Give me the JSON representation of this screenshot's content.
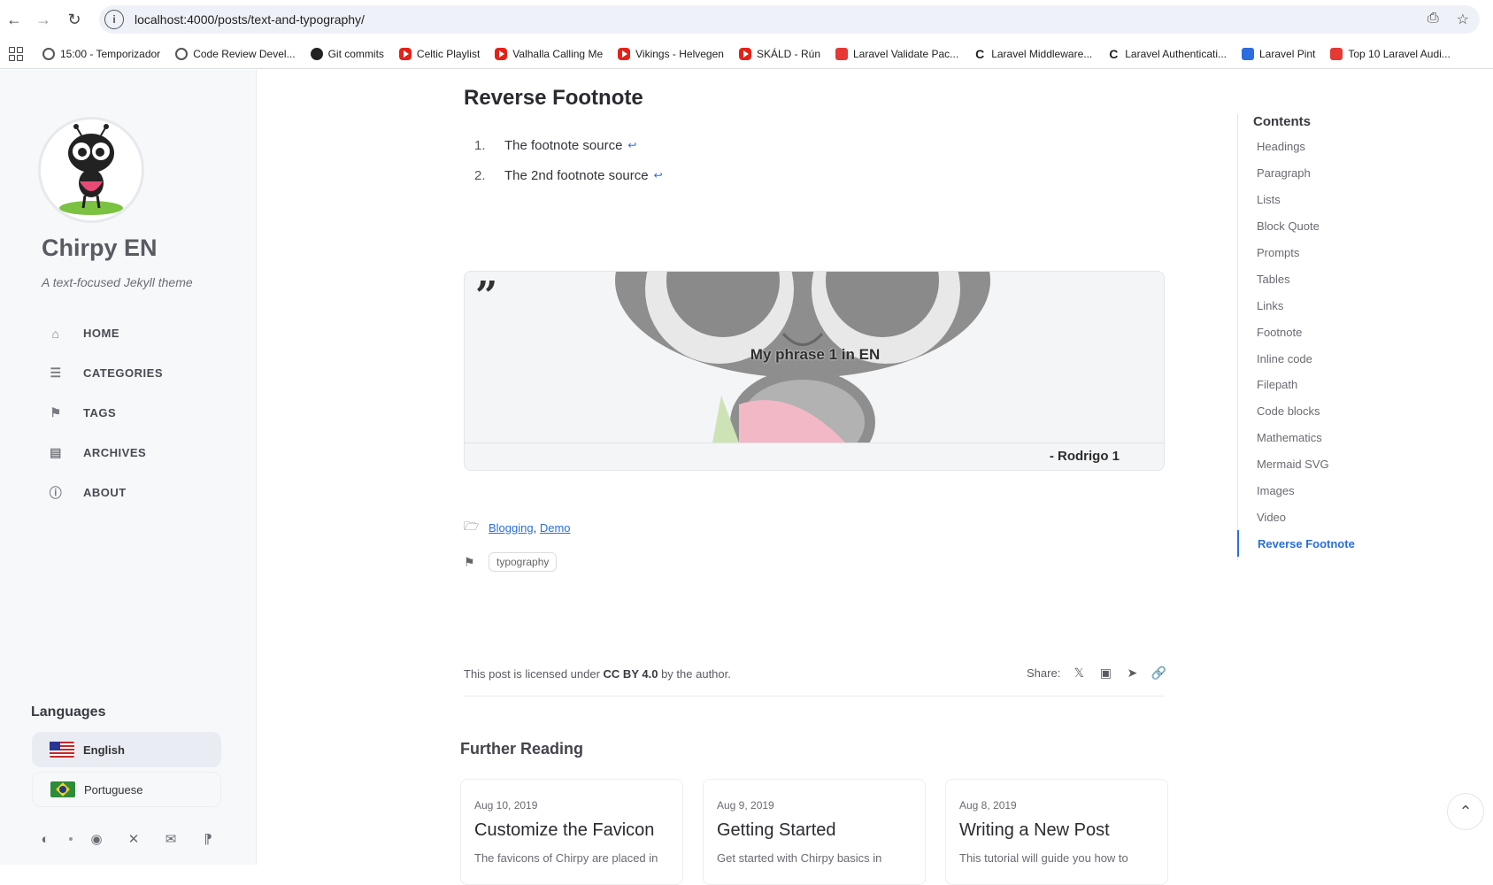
{
  "browser": {
    "url": "localhost:4000/posts/text-and-typography/",
    "bookmarks": [
      {
        "label": "15:00 - Temporizador",
        "icon": "timer-icon"
      },
      {
        "label": "Code Review Devel...",
        "icon": "globe-icon"
      },
      {
        "label": "Git commits",
        "icon": "github-icon"
      },
      {
        "label": "Celtic Playlist",
        "icon": "youtube-icon"
      },
      {
        "label": "Valhalla Calling Me",
        "icon": "youtube-icon"
      },
      {
        "label": "Vikings - Helvegen",
        "icon": "youtube-icon"
      },
      {
        "label": "SKÁLD - Rún",
        "icon": "youtube-icon"
      },
      {
        "label": "Laravel Validate Pac...",
        "icon": "laravel-news-icon"
      },
      {
        "label": "Laravel Middleware...",
        "icon": "c-icon"
      },
      {
        "label": "Laravel Authenticati...",
        "icon": "c-icon"
      },
      {
        "label": "Laravel Pint",
        "icon": "pint-icon"
      },
      {
        "label": "Top 10 Laravel Audi...",
        "icon": "laravel-news-icon"
      }
    ]
  },
  "sidebar": {
    "title": "Chirpy EN",
    "subtitle": "A text-focused Jekyll theme",
    "nav": [
      {
        "label": "HOME",
        "icon": "home-icon"
      },
      {
        "label": "CATEGORIES",
        "icon": "stream-icon"
      },
      {
        "label": "TAGS",
        "icon": "tags-icon"
      },
      {
        "label": "ARCHIVES",
        "icon": "archive-icon"
      },
      {
        "label": "ABOUT",
        "icon": "info-icon"
      }
    ],
    "languages_title": "Languages",
    "languages": [
      {
        "label": "English",
        "active": true
      },
      {
        "label": "Portuguese",
        "active": false
      }
    ]
  },
  "post": {
    "heading": "Reverse Footnote",
    "footnotes": [
      {
        "num": "1.",
        "text": "The footnote source",
        "back": "↩"
      },
      {
        "num": "2.",
        "text": "The 2nd footnote source",
        "back": "↩"
      }
    ],
    "quote": {
      "mark": "”",
      "text": "My phrase 1 in EN",
      "author": "- Rodrigo 1"
    },
    "categories": [
      "Blogging",
      "Demo"
    ],
    "category_sep": ",",
    "tags": [
      "typography"
    ],
    "license_prefix": "This post is licensed under",
    "license_name": "CC BY 4.0",
    "license_suffix": "by the author.",
    "share_label": "Share:",
    "further_title": "Further Reading",
    "cards": [
      {
        "date": "Aug 10, 2019",
        "title": "Customize the Favicon",
        "excerpt": "The favicons of Chirpy are placed in"
      },
      {
        "date": "Aug 9, 2019",
        "title": "Getting Started",
        "excerpt": "Get started with Chirpy basics in"
      },
      {
        "date": "Aug 8, 2019",
        "title": "Writing a New Post",
        "excerpt": "This tutorial will guide you how to"
      }
    ]
  },
  "toc": {
    "title": "Contents",
    "items": [
      "Headings",
      "Paragraph",
      "Lists",
      "Block Quote",
      "Prompts",
      "Tables",
      "Links",
      "Footnote",
      "Inline code",
      "Filepath",
      "Code blocks",
      "Mathematics",
      "Mermaid SVG",
      "Images",
      "Video",
      "Reverse Footnote"
    ],
    "active": "Reverse Footnote"
  },
  "colors": {
    "accent": "#2a6fdb",
    "sidebar_bg": "#f6f8fa"
  }
}
